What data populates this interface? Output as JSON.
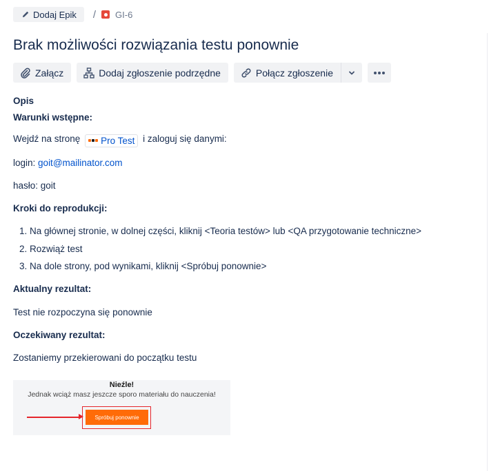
{
  "breadcrumb": {
    "epic_label": "Dodaj Epik",
    "separator": "/",
    "issue_key": "GI-6"
  },
  "issue": {
    "title": "Brak możliwości rozwiązania testu ponownie"
  },
  "toolbar": {
    "attach_label": "Załącz",
    "subtask_label": "Dodaj zgłoszenie podrzędne",
    "link_label": "Połącz zgłoszenie",
    "more_label": "•••"
  },
  "description": {
    "heading": "Opis",
    "preconditions_heading": "Warunki wstępne:",
    "visit_prefix": "Wejdź na stronę",
    "site_link": "Pro Test",
    "visit_suffix": "i zaloguj się danymi:",
    "login_label": "login:",
    "login_value": "goit@mailinator.com",
    "password_line": "hasło: goit",
    "steps_heading": "Kroki do reprodukcji:",
    "steps": [
      "Na głównej stronie, w dolnej części, kliknij <Teoria testów> lub <QA przygotowanie techniczne>",
      "Rozwiąż test",
      "Na dole strony, pod wynikami, kliknij <Spróbuj ponownie>"
    ],
    "actual_heading": "Aktualny rezultat:",
    "actual_text": "Test nie rozpoczyna się ponownie",
    "expected_heading": "Oczekiwany rezultat:",
    "expected_text": "Zostaniemy przekierowani do początku testu"
  },
  "attachment": {
    "title": "Nieźle!",
    "subtitle": "Jednak wciąż masz jeszcze sporo materiału do nauczenia!",
    "button_label": "Spróbuj ponownie"
  },
  "colors": {
    "link": "#0052cc",
    "issue_icon": "#e5493a",
    "annotation_red": "#e5242b",
    "button_orange": "#ff6b08"
  }
}
